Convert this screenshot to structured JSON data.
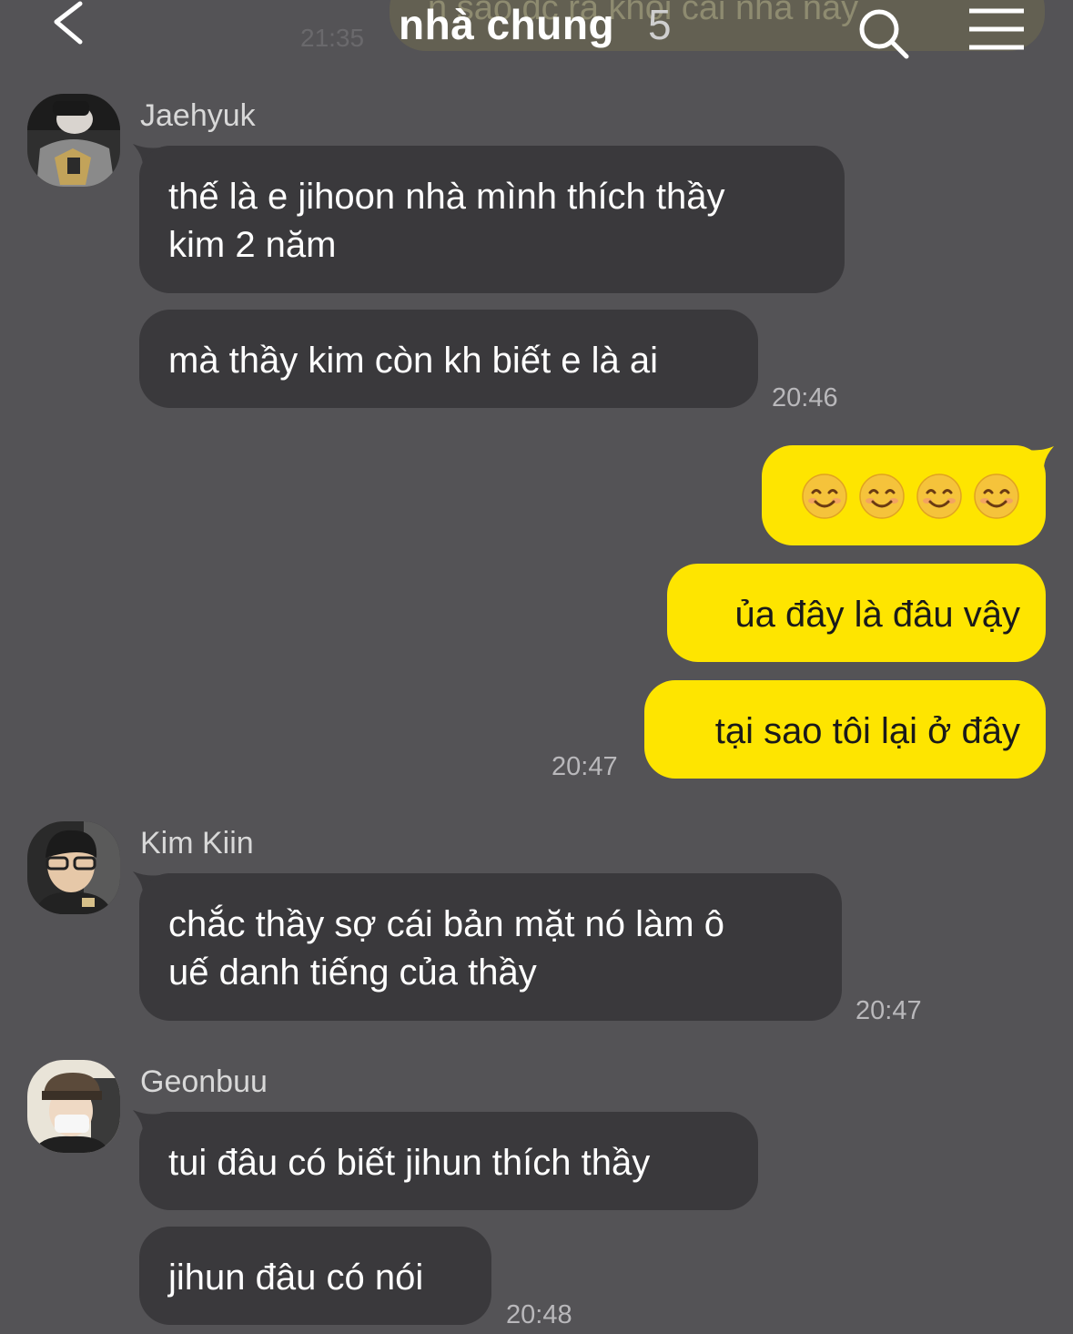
{
  "header": {
    "title": "nhà chung",
    "member_count": "5",
    "ghost_text": "n sao đc ra khỏi cái nhà này",
    "ghost_time": "21:35",
    "icons": {
      "back": "chevron-left-icon",
      "search": "search-icon",
      "menu": "hamburger-menu-icon"
    }
  },
  "messages": [
    {
      "sender": "Jaehyuk",
      "lines": [
        "thế là e jihoon nhà mình thích thầy",
        "kim 2 năm"
      ]
    },
    {
      "lines": [
        "mà thầy kim còn kh biết e là ai"
      ],
      "time": "20:46"
    },
    {
      "outgoing": true,
      "emoji": [
        "😊",
        "😊",
        "😊",
        "😊"
      ]
    },
    {
      "outgoing": true,
      "lines": [
        "ủa đây là đâu vậy"
      ]
    },
    {
      "outgoing": true,
      "lines": [
        "tại sao tôi lại ở đây"
      ],
      "time": "20:47"
    },
    {
      "sender": "Kim Kiin",
      "lines": [
        "chắc thầy sợ cái bản mặt nó làm ô",
        "uế danh tiếng của thầy"
      ],
      "time": "20:47"
    },
    {
      "sender": "Geonbuu",
      "lines": [
        "tui đâu có biết jihun thích thầy"
      ]
    },
    {
      "lines": [
        "jihun đâu có nói"
      ],
      "time": "20:48"
    }
  ],
  "colors": {
    "background": "#545356",
    "incoming_bubble": "#3a393c",
    "outgoing_bubble": "#fee500"
  }
}
